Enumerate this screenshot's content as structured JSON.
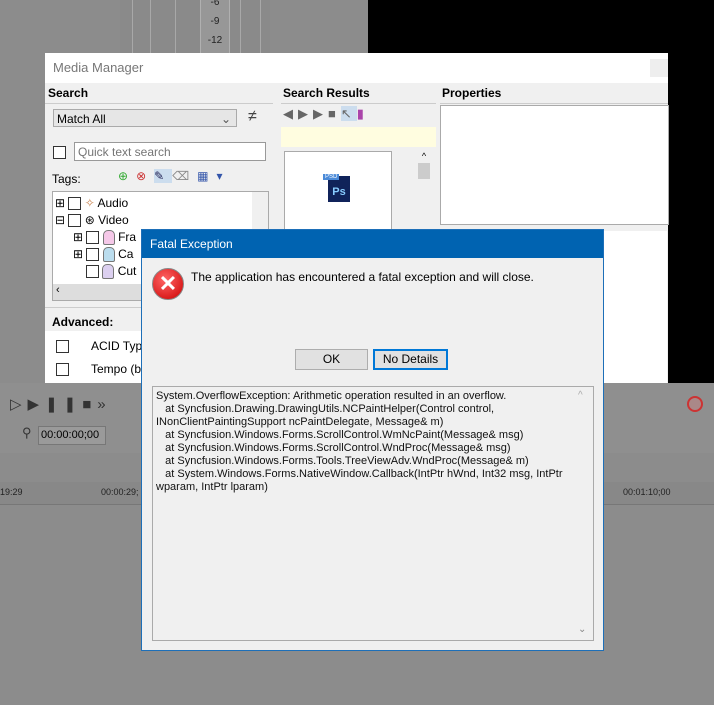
{
  "background": {
    "meter_ticks": [
      "-6",
      "-9",
      "-12"
    ],
    "transport_time": "00:00:00;00",
    "ruler_labels": [
      "19:29",
      "00:00:29;",
      "00:01:10;00"
    ]
  },
  "media_manager": {
    "title": "Media Manager",
    "search": {
      "header": "Search",
      "match_select": "Match All",
      "quick_search_placeholder": "Quick text search",
      "tags_label": "Tags:",
      "tree": [
        {
          "label": "Audio"
        },
        {
          "label": "Video"
        },
        {
          "label": "Fra"
        },
        {
          "label": "Ca"
        },
        {
          "label": "Cut"
        }
      ],
      "advanced_label": "Advanced:",
      "advanced_items": [
        "ACID Type",
        "Tempo (bp"
      ]
    },
    "results": {
      "header": "Search Results",
      "file_badge": "PSD",
      "file_icon_text": "Ps"
    },
    "properties": {
      "header": "Properties"
    }
  },
  "dialog": {
    "title": "Fatal Exception",
    "message": "The application has encountered a fatal exception and will close.",
    "ok_label": "OK",
    "details_label": "No Details",
    "details_text": "System.OverflowException: Arithmetic operation resulted in an overflow.\n   at Syncfusion.Drawing.DrawingUtils.NCPaintHelper(Control control, INonClientPaintingSupport ncPaintDelegate, Message& m)\n   at Syncfusion.Windows.Forms.ScrollControl.WmNcPaint(Message& msg)\n   at Syncfusion.Windows.Forms.ScrollControl.WndProc(Message& msg)\n   at Syncfusion.Windows.Forms.Tools.TreeViewAdv.WndProc(Message& m)\n   at System.Windows.Forms.NativeWindow.Callback(IntPtr hWnd, Int32 msg, IntPtr wparam, IntPtr lparam)"
  }
}
